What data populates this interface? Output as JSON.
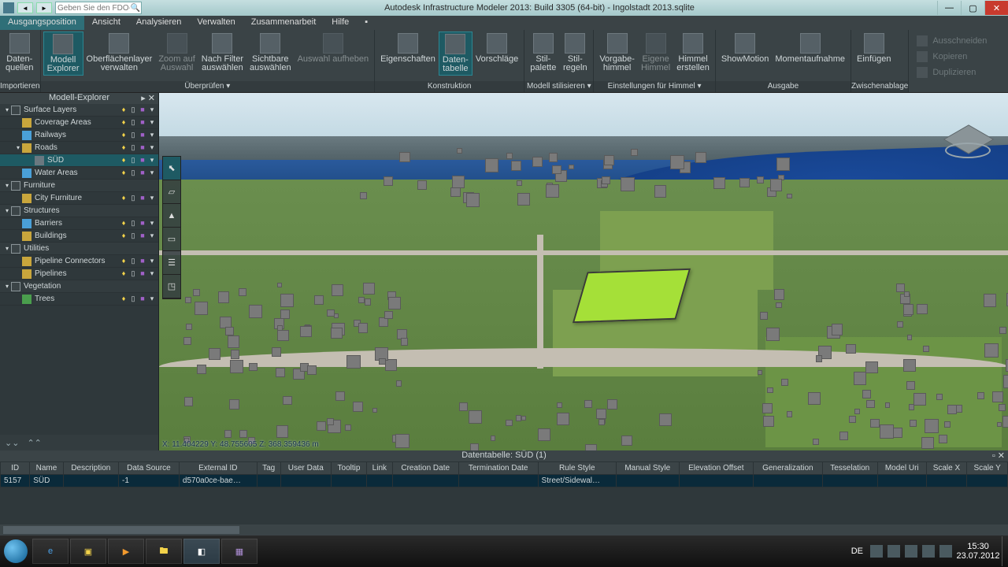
{
  "title": "Autodesk Infrastructure Modeler 2013: Build 3305 (64-bit) - Ingolstadt 2013.sqlite",
  "search_placeholder": "Geben Sie den FDO-Ausdr.",
  "menus": [
    "Ausgangsposition",
    "Ansicht",
    "Analysieren",
    "Verwalten",
    "Zusammenarbeit",
    "Hilfe"
  ],
  "menu_active": 0,
  "ribbon": {
    "groups": [
      {
        "label": "Importieren",
        "buttons": [
          {
            "l1": "Daten-",
            "l2": "quellen"
          }
        ]
      },
      {
        "label": "Überprüfen ▾",
        "buttons": [
          {
            "l1": "Modell",
            "l2": "Explorer",
            "sel": true
          },
          {
            "l1": "Oberflächenlayer",
            "l2": "verwalten"
          },
          {
            "l1": "Zoom auf",
            "l2": "Auswahl",
            "dim": true
          },
          {
            "l1": "Nach Filter",
            "l2": "auswählen"
          },
          {
            "l1": "Sichtbare",
            "l2": "auswählen"
          },
          {
            "l1": "Auswahl aufheben",
            "l2": "",
            "dim": true
          }
        ]
      },
      {
        "label": "Konstruktion",
        "buttons": [
          {
            "l1": "Eigenschaften",
            "l2": ""
          },
          {
            "l1": "Daten-",
            "l2": "tabelle",
            "sel": true
          },
          {
            "l1": "Vorschläge",
            "l2": ""
          }
        ]
      },
      {
        "label": "Modell stilisieren ▾",
        "buttons": [
          {
            "l1": "Stil-",
            "l2": "palette"
          },
          {
            "l1": "Stil-",
            "l2": "regeln"
          }
        ]
      },
      {
        "label": "Einstellungen für Himmel ▾",
        "buttons": [
          {
            "l1": "Vorgabe-",
            "l2": "himmel"
          },
          {
            "l1": "Eigene",
            "l2": "Himmel",
            "dim": true
          },
          {
            "l1": "Himmel",
            "l2": "erstellen"
          }
        ]
      },
      {
        "label": "Ausgabe",
        "buttons": [
          {
            "l1": "ShowMotion",
            "l2": ""
          },
          {
            "l1": "Momentaufnahme",
            "l2": ""
          }
        ]
      },
      {
        "label": "Zwischenablage",
        "buttons": [
          {
            "l1": "Einfügen",
            "l2": ""
          }
        ]
      }
    ],
    "clip": [
      "Ausschneiden",
      "Kopieren",
      "Duplizieren"
    ]
  },
  "explorer": {
    "title": "Modell-Explorer",
    "groups": [
      {
        "name": "Surface Layers",
        "ctrl": true,
        "items": [
          {
            "name": "Coverage Areas",
            "icon": "yellow"
          },
          {
            "name": "Railways",
            "icon": "blue"
          },
          {
            "name": "Roads",
            "icon": "yellow",
            "expanded": true,
            "children": [
              {
                "name": "SÜD",
                "sel": true
              }
            ]
          },
          {
            "name": "Water Areas",
            "icon": "blue"
          }
        ]
      },
      {
        "name": "Furniture",
        "items": [
          {
            "name": "City Furniture",
            "icon": "yellow",
            "ctrl": true
          }
        ]
      },
      {
        "name": "Structures",
        "items": [
          {
            "name": "Barriers",
            "icon": "blue"
          },
          {
            "name": "Buildings",
            "icon": "yellow",
            "ctrl": true
          }
        ]
      },
      {
        "name": "Utilities",
        "items": [
          {
            "name": "Pipeline Connectors",
            "icon": "yellow",
            "ctrl": true
          },
          {
            "name": "Pipelines",
            "icon": "yellow",
            "ctrl": true
          }
        ]
      },
      {
        "name": "Vegetation",
        "items": [
          {
            "name": "Trees",
            "icon": "green",
            "ctrl": true
          }
        ]
      }
    ]
  },
  "viewport": {
    "coords": "X: 11.404229  Y: 48.755605  Z: 368.359436 m"
  },
  "datatable": {
    "title": "Datentabelle: SÜD (1)",
    "columns": [
      "ID",
      "Name",
      "Description",
      "Data Source",
      "External ID",
      "Tag",
      "User Data",
      "Tooltip",
      "Link",
      "Creation Date",
      "Termination Date",
      "Rule Style",
      "Manual Style",
      "Elevation Offset",
      "Generalization",
      "Tesselation",
      "Model Uri",
      "Scale X",
      "Scale Y"
    ],
    "rows": [
      {
        "ID": "5157",
        "Name": "SÜD",
        "Description": "",
        "Data Source": "-1",
        "External ID": "d570a0ce-bae…",
        "Tag": "",
        "User Data": "",
        "Tooltip": "",
        "Link": "",
        "Creation Date": "",
        "Termination Date": "",
        "Rule Style": "Street/Sidewal…",
        "Manual Style": "",
        "Elevation Offset": "",
        "Generalization": "",
        "Tesselation": "",
        "Model Uri": "",
        "Scale X": "",
        "Scale Y": ""
      }
    ]
  },
  "taskbar": {
    "lang": "DE",
    "time": "15:30",
    "date": "23.07.2012"
  }
}
